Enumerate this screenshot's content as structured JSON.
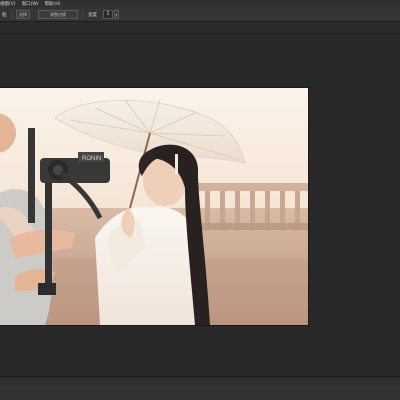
{
  "menubar": {
    "items": [
      {
        "label": "视图(V)"
      },
      {
        "label": "窗口(W)"
      },
      {
        "label": "帮助(H)"
      }
    ]
  },
  "options": {
    "left_label": "框",
    "left_button": "选择",
    "middle_button": "调整边缘",
    "right_label": "宽度",
    "value": "5"
  },
  "photo": {
    "description_icons": {
      "camera_badge": "RONIN"
    }
  }
}
